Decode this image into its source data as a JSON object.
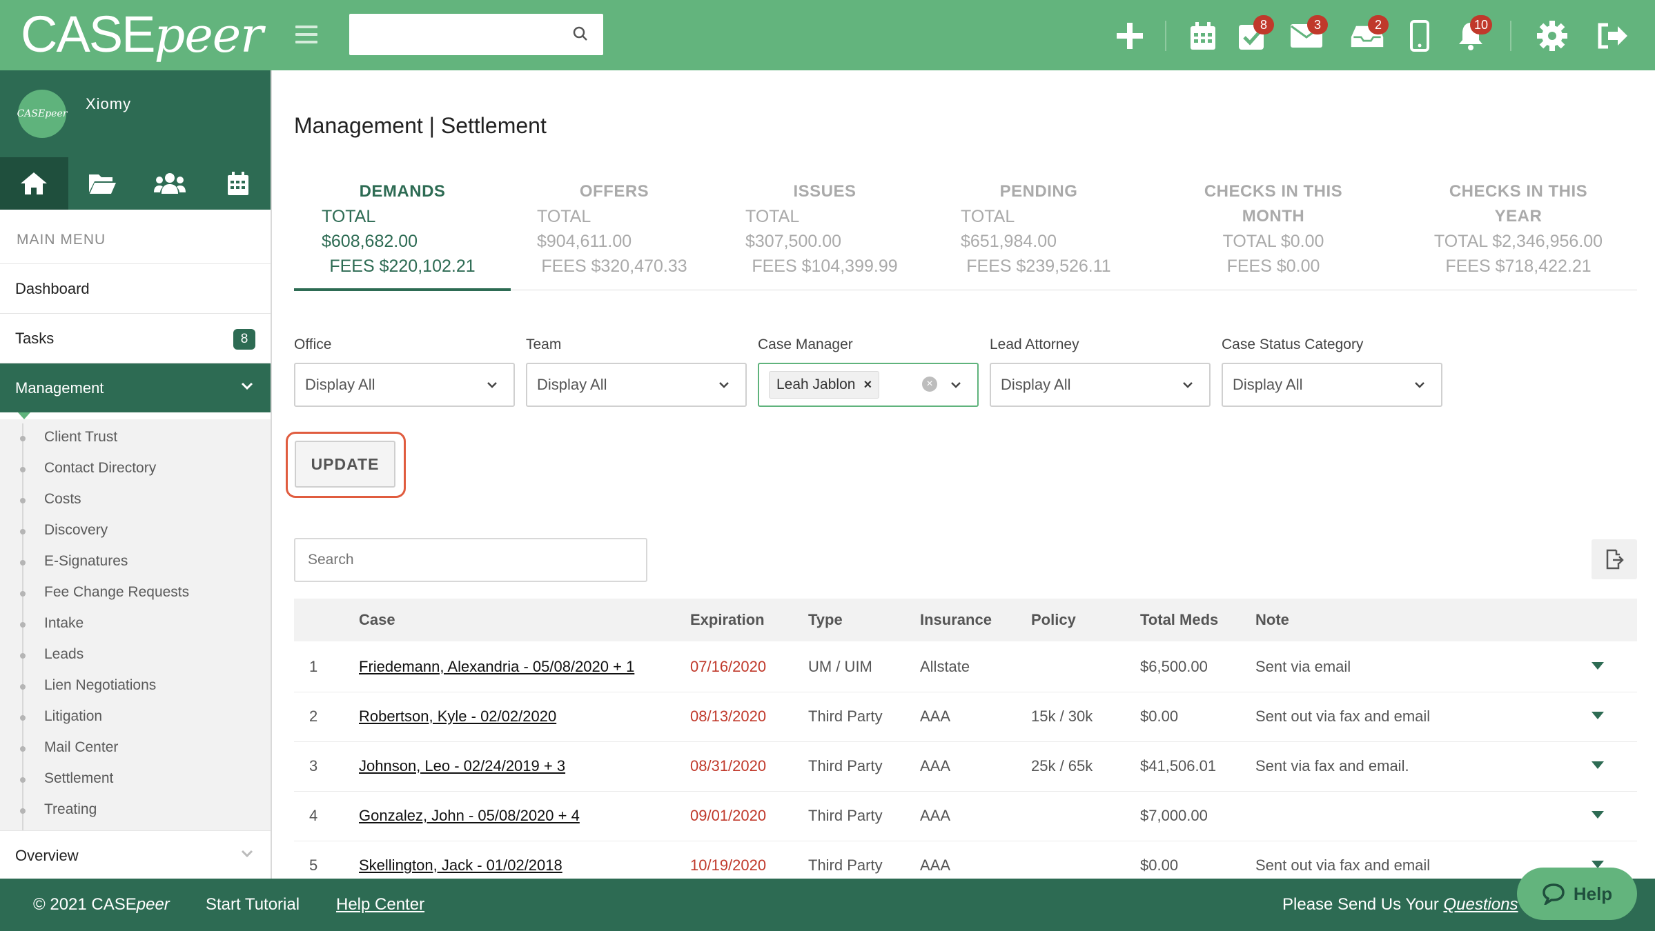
{
  "brand": {
    "name_case": "CASE",
    "name_peer": "peer",
    "avatar_text": "CASEpeer"
  },
  "topbar": {
    "search_placeholder": "",
    "icons": [
      {
        "name": "plus-icon"
      },
      {
        "name": "calendar-icon"
      },
      {
        "name": "tasks-check-icon",
        "badge": "8"
      },
      {
        "name": "mail-icon",
        "badge": "3"
      },
      {
        "name": "inbox-tray-icon",
        "badge": "2"
      },
      {
        "name": "mobile-icon"
      },
      {
        "name": "bell-icon",
        "badge": "10"
      },
      {
        "name": "gear-icon"
      },
      {
        "name": "logout-icon"
      }
    ]
  },
  "sidebar": {
    "user_name": "Xiomy",
    "tabs": [
      {
        "name": "home-icon",
        "active": true
      },
      {
        "name": "folder-icon"
      },
      {
        "name": "users-icon"
      },
      {
        "name": "calendar-icon"
      }
    ],
    "heading": "MAIN MENU",
    "dashboard": "Dashboard",
    "tasks": "Tasks",
    "tasks_count": "8",
    "management": "Management",
    "sub_items": [
      "Client Trust",
      "Contact Directory",
      "Costs",
      "Discovery",
      "E-Signatures",
      "Fee Change Requests",
      "Intake",
      "Leads",
      "Lien Negotiations",
      "Litigation",
      "Mail Center",
      "Settlement",
      "Treating"
    ],
    "overview": "Overview"
  },
  "main": {
    "title": "Management | Settlement",
    "stats": [
      {
        "label1": "DEMANDS",
        "label2": "",
        "total": "TOTAL",
        "total_value": "$608,682.00",
        "fees": "FEES $220,102.21",
        "active": true
      },
      {
        "label1": "OFFERS",
        "label2": "",
        "total": "TOTAL",
        "total_value": "$904,611.00",
        "fees": "FEES $320,470.33"
      },
      {
        "label1": "ISSUES",
        "label2": "",
        "total": "TOTAL",
        "total_value": "$307,500.00",
        "fees": "FEES $104,399.99"
      },
      {
        "label1": "PENDING",
        "label2": "",
        "total": "TOTAL",
        "total_value": "$651,984.00",
        "fees": "FEES $239,526.11"
      },
      {
        "label1": "CHECKS IN THIS",
        "label2": "MONTH",
        "total": "TOTAL $0.00",
        "total_value": "",
        "fees": "FEES $0.00"
      },
      {
        "label1": "CHECKS IN THIS",
        "label2": "YEAR",
        "total": "TOTAL $2,346,956.00",
        "total_value": "",
        "fees": "FEES $718,422.21"
      }
    ],
    "filters": {
      "office_label": "Office",
      "office_value": "Display All",
      "team_label": "Team",
      "team_value": "Display All",
      "case_manager_label": "Case Manager",
      "case_manager_chip": "Leah Jablon",
      "lead_attorney_label": "Lead Attorney",
      "lead_attorney_value": "Display All",
      "case_status_label": "Case Status Category",
      "case_status_value": "Display All"
    },
    "update_label": "UPDATE",
    "table_search_placeholder": "Search",
    "table": {
      "headers": [
        "Case",
        "Expiration",
        "Type",
        "Insurance",
        "Policy",
        "Total Meds",
        "Note"
      ],
      "rows": [
        {
          "num": "1",
          "case": "Friedemann, Alexandria - 05/08/2020 + 1",
          "expiration": "07/16/2020",
          "type": "UM / UIM",
          "insurance": "Allstate",
          "policy": "",
          "total_meds": "$6,500.00",
          "note": "Sent via email"
        },
        {
          "num": "2",
          "case": "Robertson, Kyle - 02/02/2020",
          "expiration": "08/13/2020",
          "type": "Third Party",
          "insurance": "AAA",
          "policy": "15k / 30k",
          "total_meds": "$0.00",
          "note": "Sent out via fax and email"
        },
        {
          "num": "3",
          "case": "Johnson, Leo - 02/24/2019 + 3",
          "expiration": "08/31/2020",
          "type": "Third Party",
          "insurance": "AAA",
          "policy": "25k / 65k",
          "total_meds": "$41,506.01",
          "note": "Sent via fax and email."
        },
        {
          "num": "4",
          "case": "Gonzalez, John - 05/08/2020 + 4",
          "expiration": "09/01/2020",
          "type": "Third Party",
          "insurance": "AAA",
          "policy": "",
          "total_meds": "$7,000.00",
          "note": ""
        },
        {
          "num": "5",
          "case": "Skellington, Jack - 01/02/2018",
          "expiration": "10/19/2020",
          "type": "Third Party",
          "insurance": "AAA",
          "policy": "",
          "total_meds": "$0.00",
          "note": "Sent out via fax and email"
        }
      ]
    }
  },
  "footer": {
    "copyright_prefix": "© 2021 CASE",
    "copyright_italic": "peer",
    "start_tutorial": "Start Tutorial",
    "help_center": "Help Center",
    "send_prefix": "Please Send Us Your ",
    "send_link": "Questions"
  },
  "help_button": "Help",
  "colors": {
    "brand_green": "#63b47d",
    "dark_green": "#2d6b53",
    "expiration_red": "#c0392b",
    "highlight_ring": "#e05c3f"
  }
}
